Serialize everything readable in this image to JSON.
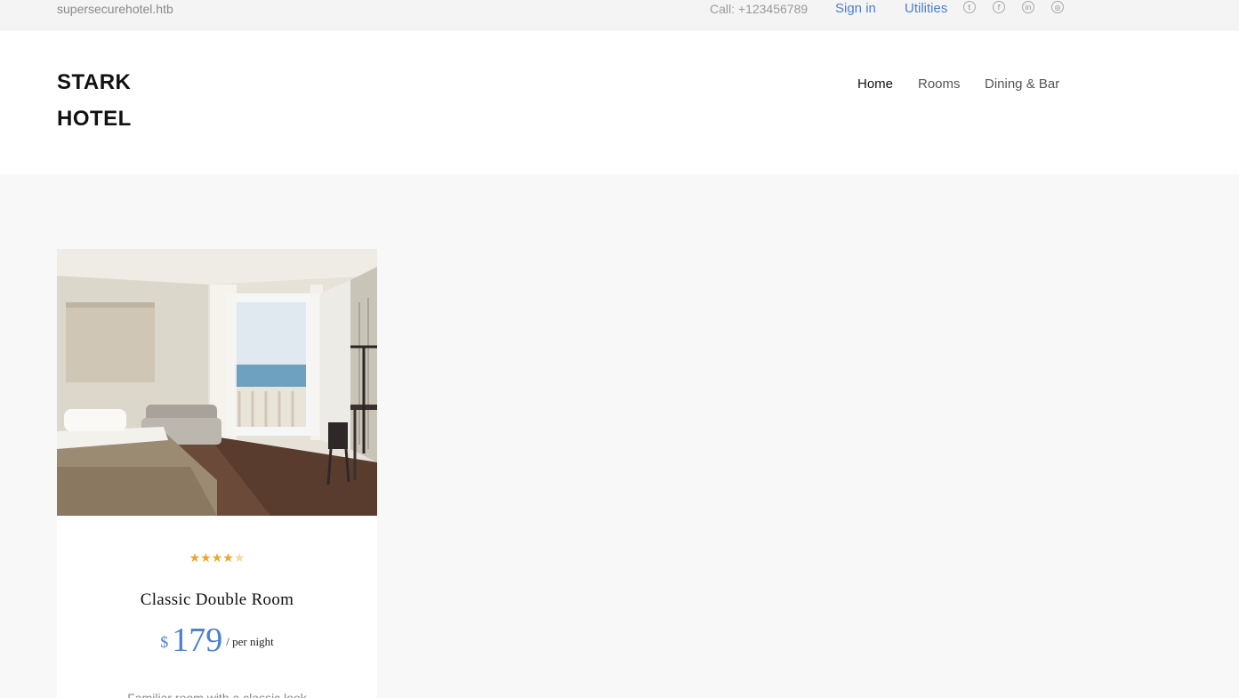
{
  "topbar": {
    "domain": "supersecurehotel.htb",
    "phone": "Call: +123456789",
    "sign_in": "Sign in",
    "utilities": "Utilities",
    "social_icons": [
      "twitter-icon",
      "facebook-icon",
      "linkedin-icon",
      "dribbble-icon"
    ]
  },
  "header": {
    "logo_line1": "STARK",
    "logo_line2": "HOTEL",
    "nav": [
      {
        "label": "Home",
        "active": true
      },
      {
        "label": "Rooms",
        "active": false
      },
      {
        "label": "Dining & Bar",
        "active": false
      }
    ]
  },
  "room": {
    "rating": 4,
    "rating_max": 5,
    "title": "Classic Double Room",
    "currency": "$",
    "price": "179",
    "per_night": "/ per night",
    "description": "Familiar room with a classic look"
  },
  "colors": {
    "accent": "#4a7fd6",
    "star": "#f0a52a",
    "background": "#f8f8f8"
  }
}
